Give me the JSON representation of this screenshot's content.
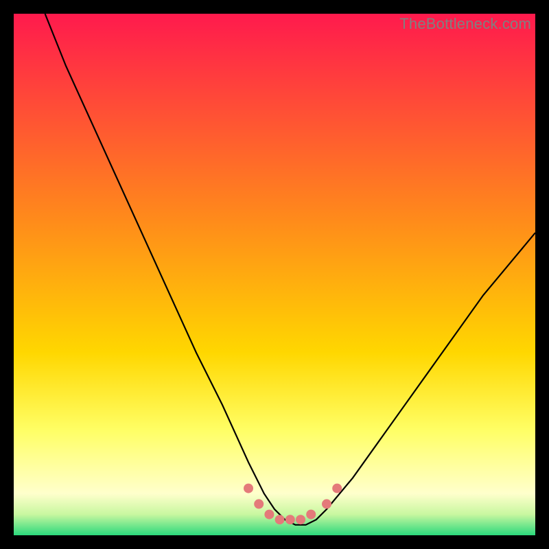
{
  "watermark": "TheBottleneck.com",
  "colors": {
    "black": "#000000",
    "curve": "#000000",
    "marker_fill": "#e47a7a",
    "marker_stroke": "#d66",
    "grad_top": "#ff1a4d",
    "grad_mid": "#ffd700",
    "grad_low": "#ffff66",
    "grad_bottom": "#2bd97c",
    "watermark_text": "#808080"
  },
  "chart_data": {
    "type": "line",
    "title": "",
    "xlabel": "",
    "ylabel": "",
    "xlim": [
      0,
      100
    ],
    "ylim": [
      0,
      100
    ],
    "gradient_bands_pct": {
      "red_to_yellow": [
        0,
        78
      ],
      "pale_yellow": [
        78,
        92
      ],
      "green": [
        92,
        100
      ]
    },
    "series": [
      {
        "name": "bottleneck-curve",
        "note": "V-shaped dip; y is bottleneck %, x is relative performance. Values estimated from pixels.",
        "x": [
          6,
          10,
          15,
          20,
          25,
          30,
          35,
          40,
          45,
          48,
          50,
          52,
          54,
          56,
          58,
          60,
          65,
          70,
          75,
          80,
          85,
          90,
          95,
          100
        ],
        "y": [
          100,
          90,
          79,
          68,
          57,
          46,
          35,
          25,
          14,
          8,
          5,
          3,
          2,
          2,
          3,
          5,
          11,
          18,
          25,
          32,
          39,
          46,
          52,
          58
        ]
      }
    ],
    "markers": {
      "name": "min-region-dots",
      "x": [
        45,
        47,
        49,
        51,
        53,
        55,
        57,
        60,
        62
      ],
      "y": [
        9,
        6,
        4,
        3,
        3,
        3,
        4,
        6,
        9
      ]
    }
  }
}
